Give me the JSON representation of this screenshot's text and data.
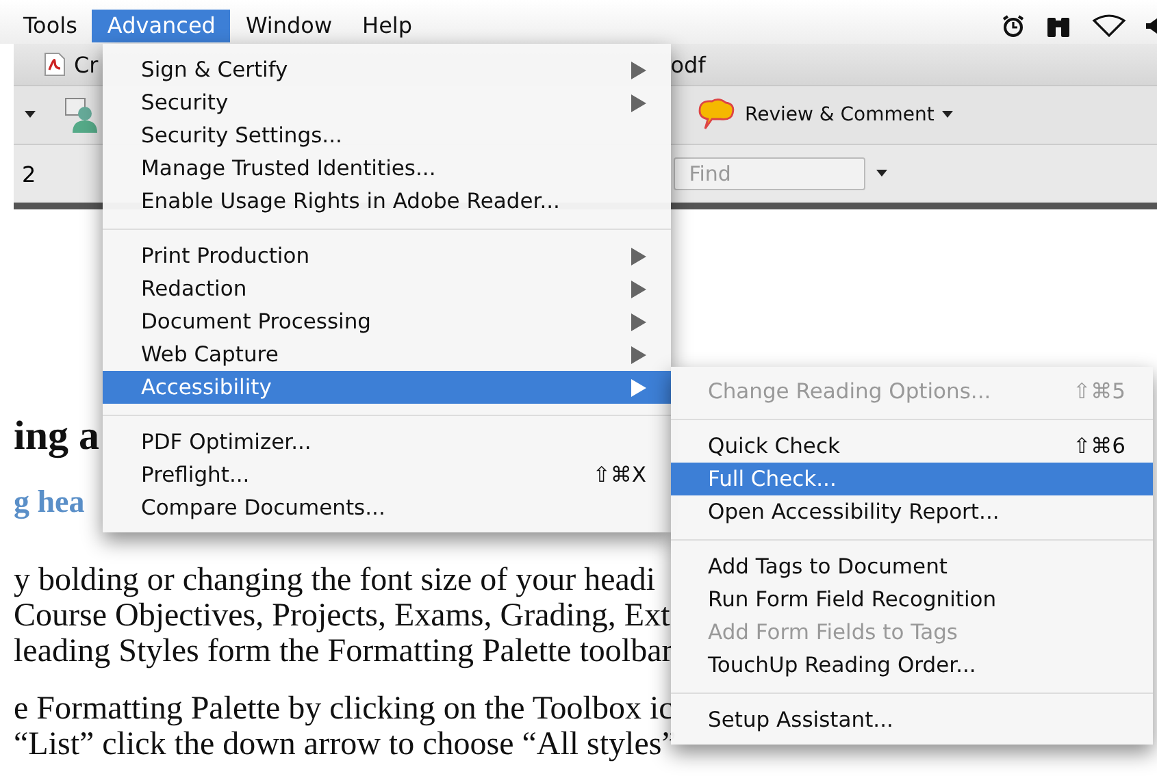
{
  "menubar": {
    "items": [
      {
        "label": "Tools",
        "selected": false
      },
      {
        "label": "Advanced",
        "selected": true
      },
      {
        "label": "Window",
        "selected": false
      },
      {
        "label": "Help",
        "selected": false
      }
    ]
  },
  "document_tab": {
    "title_start": "Cr",
    "title_end": "odf"
  },
  "toolbar": {
    "review_button": {
      "label": "Review & Comment"
    }
  },
  "navigation": {
    "page_number": "2",
    "find_field": {
      "placeholder": "Find"
    }
  },
  "document": {
    "heading": "ing a",
    "subheading": "g hea",
    "paragraphs": [
      [
        "y bolding or changing the font size of your headi",
        "Course Objectives, Projects, Exams, Grading, Ext",
        "leading Styles form the Formatting Palette toolbar"
      ],
      [
        "e Formatting Palette by clicking on the Toolbox ic",
        "“List” click the down arrow to choose “All styles”"
      ]
    ]
  },
  "menu": {
    "items": [
      {
        "kind": "item",
        "label": "Sign & Certify",
        "submenu": true,
        "selected": false,
        "disabled": false
      },
      {
        "kind": "item",
        "label": "Security",
        "submenu": true,
        "selected": false,
        "disabled": false
      },
      {
        "kind": "item",
        "label": "Security Settings...",
        "submenu": false,
        "selected": false,
        "disabled": false
      },
      {
        "kind": "item",
        "label": "Manage Trusted Identities...",
        "submenu": false,
        "selected": false,
        "disabled": false
      },
      {
        "kind": "item",
        "label": "Enable Usage Rights in Adobe Reader...",
        "submenu": false,
        "selected": false,
        "disabled": false
      },
      {
        "kind": "separator"
      },
      {
        "kind": "item",
        "label": "Print Production",
        "submenu": true,
        "selected": false,
        "disabled": false
      },
      {
        "kind": "item",
        "label": "Redaction",
        "submenu": true,
        "selected": false,
        "disabled": false
      },
      {
        "kind": "item",
        "label": "Document Processing",
        "submenu": true,
        "selected": false,
        "disabled": false
      },
      {
        "kind": "item",
        "label": "Web Capture",
        "submenu": true,
        "selected": false,
        "disabled": false
      },
      {
        "kind": "item",
        "label": "Accessibility",
        "submenu": true,
        "selected": true,
        "disabled": false
      },
      {
        "kind": "separator"
      },
      {
        "kind": "item",
        "label": "PDF Optimizer...",
        "submenu": false,
        "selected": false,
        "disabled": false
      },
      {
        "kind": "item",
        "label": "Preflight...",
        "shortcut": "⇧⌘X",
        "submenu": false,
        "selected": false,
        "disabled": false
      },
      {
        "kind": "item",
        "label": "Compare Documents...",
        "submenu": false,
        "selected": false,
        "disabled": false
      }
    ]
  },
  "submenu": {
    "items": [
      {
        "kind": "item",
        "label": "Change Reading Options...",
        "shortcut": "⇧⌘5",
        "selected": false,
        "disabled": true
      },
      {
        "kind": "separator"
      },
      {
        "kind": "item",
        "label": "Quick Check",
        "shortcut": "⇧⌘6",
        "selected": false,
        "disabled": false
      },
      {
        "kind": "item",
        "label": "Full Check...",
        "selected": true,
        "disabled": false
      },
      {
        "kind": "item",
        "label": "Open Accessibility Report...",
        "selected": false,
        "disabled": false
      },
      {
        "kind": "separator"
      },
      {
        "kind": "item",
        "label": "Add Tags to Document",
        "selected": false,
        "disabled": false
      },
      {
        "kind": "item",
        "label": "Run Form Field Recognition",
        "selected": false,
        "disabled": false
      },
      {
        "kind": "item",
        "label": "Add Form Fields to Tags",
        "selected": false,
        "disabled": true
      },
      {
        "kind": "item",
        "label": "TouchUp Reading Order...",
        "selected": false,
        "disabled": false
      },
      {
        "kind": "separator"
      },
      {
        "kind": "item",
        "label": "Setup Assistant...",
        "selected": false,
        "disabled": false
      }
    ]
  }
}
